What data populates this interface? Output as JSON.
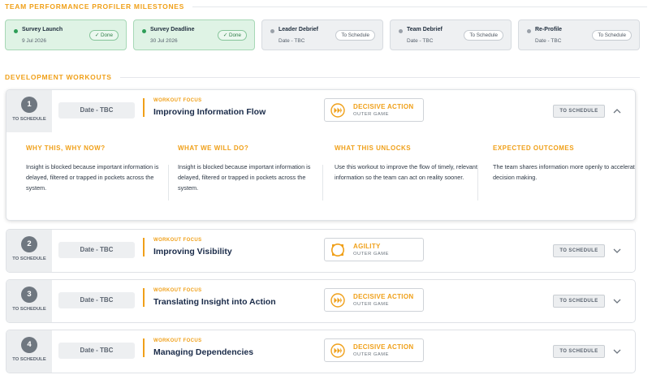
{
  "milestones_section": {
    "title": "TEAM PERFORMANCE PROFILER MILESTONES"
  },
  "milestones": [
    {
      "name": "Survey Launch",
      "date": "9 Jul 2026",
      "status": "Done",
      "done": true
    },
    {
      "name": "Survey Deadline",
      "date": "30 Jul 2026",
      "status": "Done",
      "done": true
    },
    {
      "name": "Leader Debrief",
      "date": "Date - TBC",
      "status": "To Schedule",
      "done": false
    },
    {
      "name": "Team Debrief",
      "date": "Date - TBC",
      "status": "To Schedule",
      "done": false
    },
    {
      "name": "Re-Profile",
      "date": "Date - TBC",
      "status": "To Schedule",
      "done": false
    }
  ],
  "workouts_section": {
    "title": "DEVELOPMENT WORKOUTS"
  },
  "workouts": [
    {
      "number": "1",
      "status": "TO SCHEDULE",
      "date": "Date - TBC",
      "focus_label": "WORKOUT FOCUS",
      "focus_title": "Improving Information Flow",
      "skill": "DECISIVE ACTION",
      "game": "OUTER GAME",
      "icon": "fast-forward-icon",
      "button": "TO SCHEDULE",
      "expanded": true
    },
    {
      "number": "2",
      "status": "TO SCHEDULE",
      "date": "Date - TBC",
      "focus_label": "WORKOUT FOCUS",
      "focus_title": "Improving Visibility",
      "skill": "AGILITY",
      "game": "OUTER GAME",
      "icon": "agility-arrows-icon",
      "button": "TO SCHEDULE",
      "expanded": false
    },
    {
      "number": "3",
      "status": "TO SCHEDULE",
      "date": "Date - TBC",
      "focus_label": "WORKOUT FOCUS",
      "focus_title": "Translating Insight into Action",
      "skill": "DECISIVE ACTION",
      "game": "OUTER GAME",
      "icon": "fast-forward-icon",
      "button": "TO SCHEDULE",
      "expanded": false
    },
    {
      "number": "4",
      "status": "TO SCHEDULE",
      "date": "Date - TBC",
      "focus_label": "WORKOUT FOCUS",
      "focus_title": "Managing Dependencies",
      "skill": "DECISIVE ACTION",
      "game": "OUTER GAME",
      "icon": "fast-forward-icon",
      "button": "TO SCHEDULE",
      "expanded": false
    }
  ],
  "workout_details": [
    {
      "heading": "WHY THIS, WHY NOW?",
      "text": "Insight is blocked because important information is delayed, filtered or trapped in pockets across the system."
    },
    {
      "heading": "WHAT WE WILL DO?",
      "text": "Insight is blocked because important information is delayed, filtered or trapped in pockets across the system."
    },
    {
      "heading": "WHAT THIS UNLOCKS",
      "text": "Use this workout to improve the flow of timely, relevant information so the team can act on reality sooner."
    },
    {
      "heading": "EXPECTED OUTCOMES",
      "text": "The team shares information more openly to accelerate decision making."
    }
  ],
  "colors": {
    "accent": "#f0a019",
    "done_green": "#2e9e58",
    "done_bg": "#dff3e5",
    "pending_grey": "#9aa1a9",
    "title_navy": "#1a2b49"
  }
}
